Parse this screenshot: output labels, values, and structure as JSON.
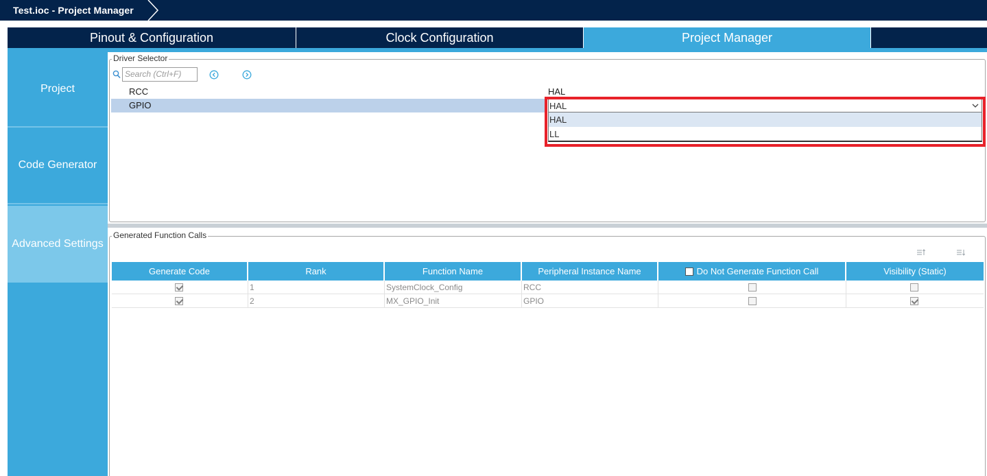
{
  "window": {
    "title": "Test.ioc - Project Manager"
  },
  "tabs": [
    {
      "label": "Pinout & Configuration",
      "active": false
    },
    {
      "label": "Clock Configuration",
      "active": false
    },
    {
      "label": "Project Manager",
      "active": true
    }
  ],
  "sidebar": {
    "items": [
      {
        "label": "Project",
        "active": false
      },
      {
        "label": "Code Generator",
        "active": false
      },
      {
        "label": "Advanced Settings",
        "active": true
      }
    ]
  },
  "driver_selector": {
    "legend": "Driver Selector",
    "search_placeholder": "Search (Ctrl+F)",
    "rows": [
      {
        "name": "RCC",
        "driver": "HAL"
      },
      {
        "name": "GPIO",
        "driver": "HAL"
      }
    ],
    "dropdown": {
      "selected": "HAL",
      "options": [
        "HAL",
        "LL"
      ],
      "highlighted_index": 0
    }
  },
  "function_calls": {
    "legend": "Generated Function Calls",
    "columns": [
      "Generate Code",
      "Rank",
      "Function Name",
      "Peripheral Instance Name",
      "Do Not Generate Function Call",
      "Visibility (Static)"
    ],
    "rows": [
      {
        "generate": true,
        "rank": "1",
        "function": "SystemClock_Config",
        "instance": "RCC",
        "do_not_generate": false,
        "visibility_static": false
      },
      {
        "generate": true,
        "rank": "2",
        "function": "MX_GPIO_Init",
        "instance": "GPIO",
        "do_not_generate": false,
        "visibility_static": true
      }
    ]
  },
  "colors": {
    "navy": "#03234b",
    "accent": "#3ca9dc",
    "highlight_red": "#e8222a"
  }
}
